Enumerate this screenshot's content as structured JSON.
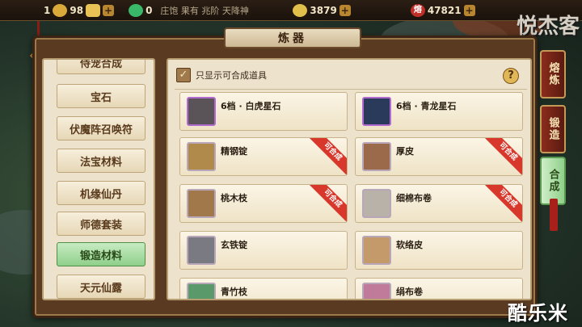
{
  "resources": {
    "gold_count": "1",
    "gold_secondary": "98",
    "jade": "0",
    "coin": "3879",
    "melt_badge": "熔",
    "melt": "47821",
    "marquee": "庄饱  果有  兆阶  天降神"
  },
  "panel": {
    "title": "炼器"
  },
  "categories": [
    {
      "label": "侍宠合成",
      "active": false
    },
    {
      "label": "宝石",
      "active": false
    },
    {
      "label": "伏魔阵召唤符",
      "active": false
    },
    {
      "label": "法宝材料",
      "active": false
    },
    {
      "label": "机缘仙丹",
      "active": false
    },
    {
      "label": "师德套装",
      "active": false
    },
    {
      "label": "锻造材料",
      "active": true
    },
    {
      "label": "天元仙露",
      "active": false
    }
  ],
  "filter": {
    "label": "只显示可合成道具",
    "checked": true,
    "check_glyph": "✓"
  },
  "help": {
    "label": "?"
  },
  "items": [
    {
      "name": "6档 · 白虎星石",
      "craftable": false,
      "icon": "white-tiger-stone-icon"
    },
    {
      "name": "6档 · 青龙星石",
      "craftable": false,
      "icon": "azure-dragon-stone-icon"
    },
    {
      "name": "精钢锭",
      "craftable": true,
      "icon": "steel-ingot-icon"
    },
    {
      "name": "厚皮",
      "craftable": true,
      "icon": "thick-hide-icon"
    },
    {
      "name": "桃木枝",
      "craftable": true,
      "icon": "peach-wood-icon"
    },
    {
      "name": "细棉布卷",
      "craftable": true,
      "icon": "cotton-roll-icon"
    },
    {
      "name": "玄铁锭",
      "craftable": false,
      "icon": "black-iron-ingot-icon"
    },
    {
      "name": "软络皮",
      "craftable": false,
      "icon": "soft-leather-icon"
    },
    {
      "name": "青竹枝",
      "craftable": false,
      "icon": "green-bamboo-icon"
    },
    {
      "name": "绢布卷",
      "craftable": false,
      "icon": "silk-roll-icon"
    }
  ],
  "ribbon_label": "可合成",
  "side_tabs": [
    {
      "label": "熔炼",
      "active": false
    },
    {
      "label": "锻造",
      "active": false
    },
    {
      "label": "合成",
      "active": true
    }
  ],
  "brand": "悦杰客",
  "watermark": "酷乐米",
  "colors": {
    "active_tab": "#8fd08a",
    "ribbon": "#d8382c",
    "side_tab": "#8a2c1c"
  }
}
